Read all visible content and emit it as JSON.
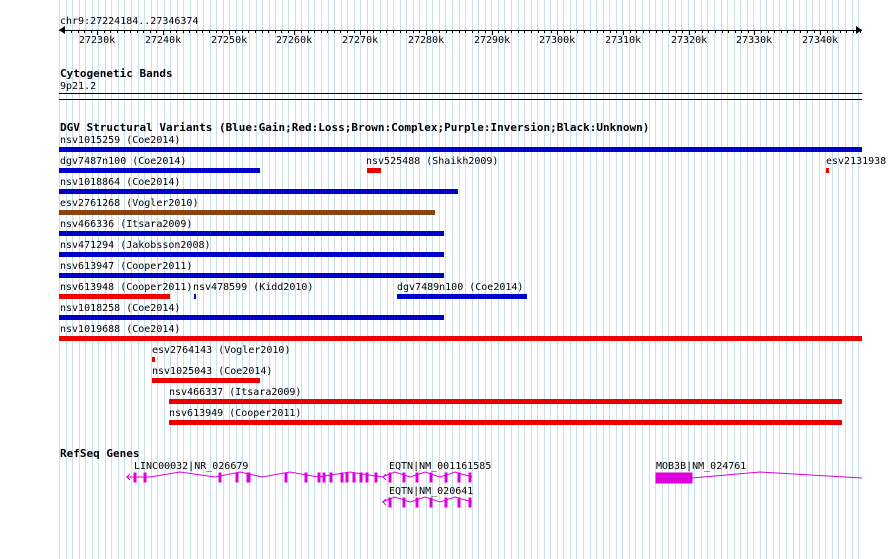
{
  "ruler": {
    "region": "chr9:27224184..27346374",
    "ticks": [
      "27230k",
      "27240k",
      "27250k",
      "27260k",
      "27270k",
      "27280k",
      "27290k",
      "27300k",
      "27310k",
      "27320k",
      "27330k",
      "27340k"
    ]
  },
  "cytobands": {
    "title": "Cytogenetic Bands",
    "band": "9p21.2"
  },
  "dgv": {
    "title": "DGV Structural Variants (Blue:Gain;Red:Loss;Brown:Complex;Purple:Inversion;Black:Unknown)",
    "variants": [
      {
        "label": "nsv1015259 (Coe2014)",
        "color": "#0000cc"
      },
      {
        "label": "dgv7487n100 (Coe2014)",
        "color": "#0000cc"
      },
      {
        "label": "nsv525488 (Shaikh2009)",
        "color": "#ee0000"
      },
      {
        "label": "esv2131938",
        "color": "#ee0000"
      },
      {
        "label": "nsv1018864 (Coe2014)",
        "color": "#0000cc"
      },
      {
        "label": "esv2761268 (Vogler2010)",
        "color": "#8b4513"
      },
      {
        "label": "nsv466336 (Itsara2009)",
        "color": "#0000cc"
      },
      {
        "label": "nsv471294 (Jakobsson2008)",
        "color": "#0000cc"
      },
      {
        "label": "nsv613947 (Cooper2011)",
        "color": "#0000cc"
      },
      {
        "label": "nsv613948 (Cooper2011)",
        "color": "#ee0000"
      },
      {
        "label": "nsv478599 (Kidd2010)",
        "color": "#0000cc"
      },
      {
        "label": "dgv7489n100 (Coe2014)",
        "color": "#0000cc"
      },
      {
        "label": "nsv1018258 (Coe2014)",
        "color": "#0000cc"
      },
      {
        "label": "nsv1019688 (Coe2014)",
        "color": "#ee0000"
      },
      {
        "label": "esv2764143 (Vogler2010)",
        "color": "#ee0000"
      },
      {
        "label": "nsv1025043 (Coe2014)",
        "color": "#ee0000"
      },
      {
        "label": "nsv466337 (Itsara2009)",
        "color": "#ee0000"
      },
      {
        "label": "nsv613949 (Cooper2011)",
        "color": "#ee0000"
      }
    ]
  },
  "refseq": {
    "title": "RefSeq Genes",
    "color": "#dd00dd",
    "genes": [
      "LINC00032|NR_026679",
      "EQTN|NM_001161585",
      "EQTN|NM_020641",
      "MOB3B|NM_024761"
    ]
  }
}
